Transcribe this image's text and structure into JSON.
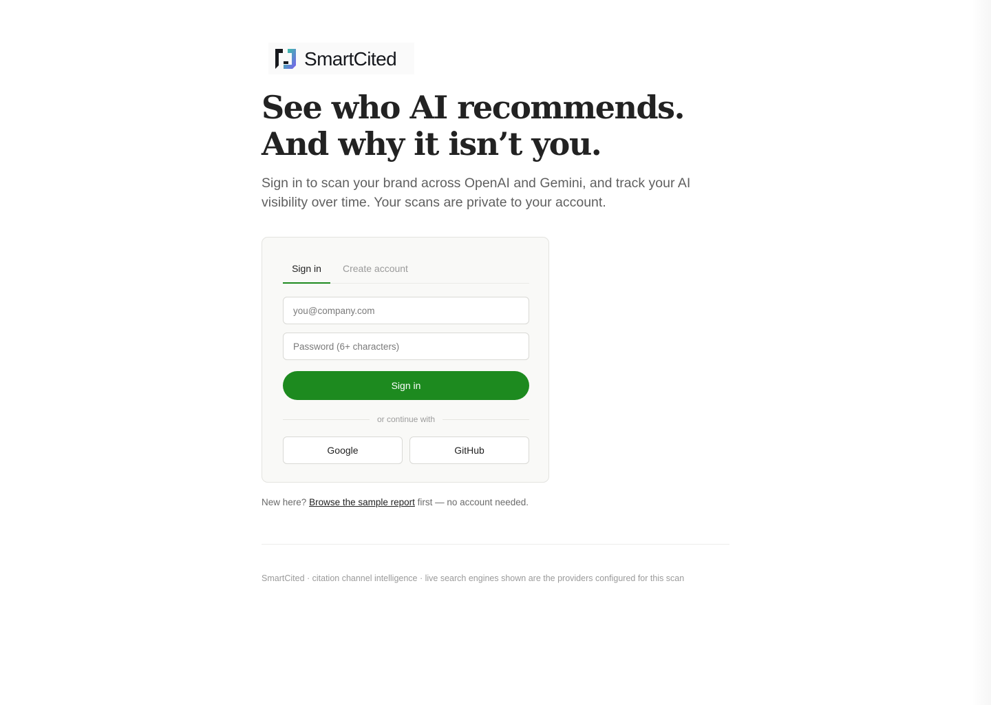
{
  "brand": {
    "name": "SmartCited",
    "icon": "smartcited-logo-mark",
    "colors": {
      "dark": "#16181d",
      "gradient_start": "#2fd39a",
      "gradient_end": "#7b5cf0"
    }
  },
  "hero": {
    "headline_line1": "See who AI recommends.",
    "headline_line2": "And why it isn’t you.",
    "subtitle": "Sign in to scan your brand across OpenAI and Gemini, and track your AI visibility over time. Your scans are private to your account."
  },
  "auth_card": {
    "tabs": [
      {
        "label": "Sign in",
        "active": true
      },
      {
        "label": "Create account",
        "active": false
      }
    ],
    "email": {
      "placeholder": "you@company.com",
      "value": ""
    },
    "password": {
      "placeholder": "Password (6+ characters)",
      "value": ""
    },
    "submit_label": "Sign in",
    "divider_text": "or continue with",
    "social": [
      {
        "label": "Google"
      },
      {
        "label": "GitHub"
      }
    ]
  },
  "note": {
    "prefix": "New here?",
    "link": "Browse the sample report",
    "suffix": "first — no account needed."
  },
  "footer": {
    "text": "SmartCited · citation channel intelligence · live search engines shown are the providers configured for this scan"
  },
  "colors": {
    "accent": "#1d8a1f",
    "card_bg": "#f9f9f7",
    "muted_text": "#9a9a9a"
  }
}
